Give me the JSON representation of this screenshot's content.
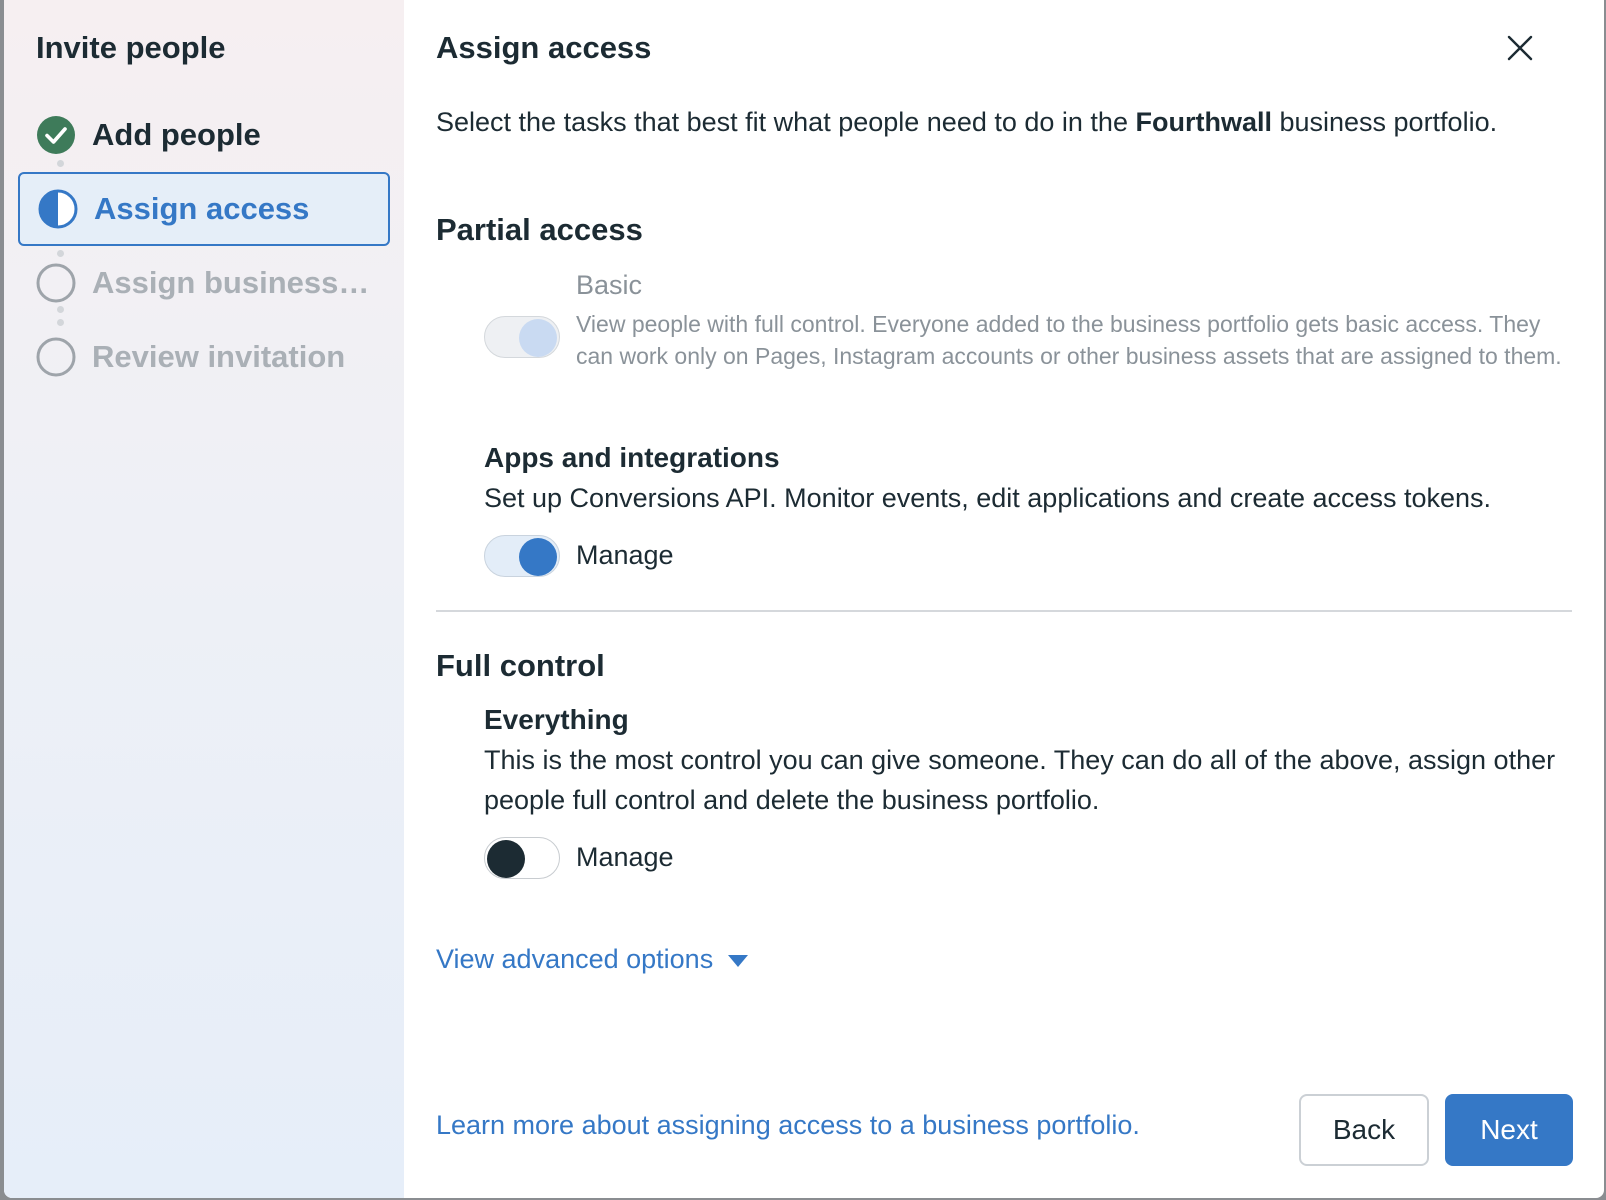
{
  "sidebar": {
    "title": "Invite people",
    "steps": [
      {
        "label": "Add people",
        "state": "done"
      },
      {
        "label": "Assign access",
        "state": "active"
      },
      {
        "label": "Assign business a...",
        "state": "pending"
      },
      {
        "label": "Review invitation",
        "state": "pending"
      }
    ]
  },
  "main": {
    "title": "Assign access",
    "close_icon": "close-icon",
    "intro": {
      "before": "Select the tasks that best fit what people need to do in the ",
      "business_name": "Fourthwall",
      "after": " business portfolio."
    },
    "partial_access": {
      "title": "Partial access",
      "basic": {
        "label": "Basic",
        "description": "View people with full control. Everyone added to the business portfolio gets basic access. They can work only on Pages, Instagram accounts or other business assets that are assigned to them.",
        "enabled": true,
        "locked": true
      },
      "apps": {
        "title": "Apps and integrations",
        "description": "Set up Conversions API. Monitor events, edit applications and create access tokens.",
        "toggle_label": "Manage",
        "enabled": true
      }
    },
    "full_control": {
      "title": "Full control",
      "everything": {
        "title": "Everything",
        "description": "This is the most control you can give someone. They can do all of the above, assign other people full control and delete the business portfolio.",
        "toggle_label": "Manage",
        "enabled": false
      }
    },
    "advanced_link": "View advanced options",
    "learn_more_link": "Learn more about assigning access to a business portfolio.",
    "back_button": "Back",
    "next_button": "Next"
  },
  "colors": {
    "accent": "#3578c6",
    "success": "#3e7b5a",
    "text": "#1c2b33",
    "muted": "#8a9299"
  }
}
